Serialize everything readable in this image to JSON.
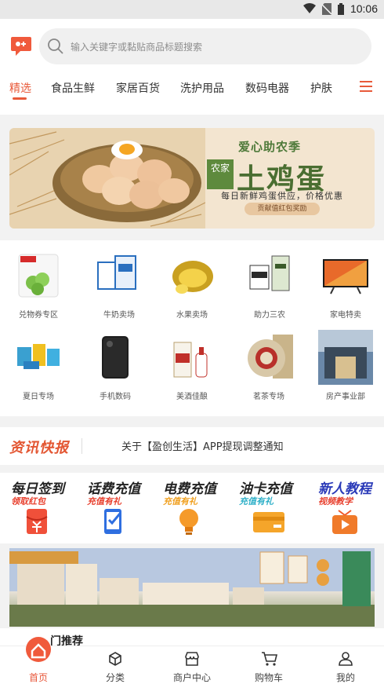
{
  "status_bar": {
    "time": "10:06",
    "icons": [
      "wifi-icon",
      "no-sim-icon",
      "battery-icon"
    ]
  },
  "search": {
    "placeholder": "输入关键字或黏贴商品标题搜索"
  },
  "tabs": [
    {
      "label": "精选",
      "active": true
    },
    {
      "label": "食品生鲜"
    },
    {
      "label": "家居百货"
    },
    {
      "label": "洗护用品"
    },
    {
      "label": "数码电器"
    },
    {
      "label": "护肤"
    }
  ],
  "banner": {
    "title_small": "爱心助农季",
    "badge": "农家",
    "title_big": "土鸡蛋",
    "subtitle": "每日新鲜鸡蛋供应，价格优惠",
    "pill": "贡献值红包奖励"
  },
  "categories": [
    {
      "label": "兑物券专区",
      "icon": "snack-bag-icon"
    },
    {
      "label": "牛奶卖场",
      "icon": "milk-box-icon"
    },
    {
      "label": "水果卖场",
      "icon": "durian-icon"
    },
    {
      "label": "助力三农",
      "icon": "farm-goods-icon"
    },
    {
      "label": "家电特卖",
      "icon": "tv-icon"
    },
    {
      "label": "夏日专场",
      "icon": "summer-goods-icon"
    },
    {
      "label": "手机数码",
      "icon": "phone-icon"
    },
    {
      "label": "美酒佳酿",
      "icon": "liquor-icon"
    },
    {
      "label": "茗茶专场",
      "icon": "tea-cake-icon"
    },
    {
      "label": "房产事业部",
      "icon": "building-icon"
    }
  ],
  "news": {
    "logo": "资讯快报",
    "headline": "关于【盈创生活】APP提现调整通知"
  },
  "actions": [
    {
      "title": "每日签到",
      "subtitle": "领取红包",
      "subtitle_color": "#e8402e",
      "icon": "red-envelope-icon"
    },
    {
      "title": "话费充值",
      "subtitle": "充值有礼",
      "subtitle_color": "#e8402e",
      "icon": "phone-check-icon"
    },
    {
      "title": "电费充值",
      "subtitle": "充值有礼",
      "subtitle_color": "#f0a020",
      "icon": "lightbulb-icon"
    },
    {
      "title": "油卡充值",
      "subtitle": "充值有礼",
      "subtitle_color": "#2fb0c8",
      "icon": "card-icon"
    },
    {
      "title": "新人教程",
      "subtitle": "视频教学",
      "subtitle_color": "#e8402e",
      "icon": "tv-play-icon"
    }
  ],
  "hot_label": "门推荐",
  "bottom_nav": [
    {
      "label": "首页",
      "active": true,
      "icon": "home-icon"
    },
    {
      "label": "分类",
      "icon": "cube-icon"
    },
    {
      "label": "商户中心",
      "icon": "store-icon"
    },
    {
      "label": "购物车",
      "icon": "cart-icon"
    },
    {
      "label": "我的",
      "icon": "person-icon"
    }
  ],
  "colors": {
    "accent": "#e85a3a"
  }
}
